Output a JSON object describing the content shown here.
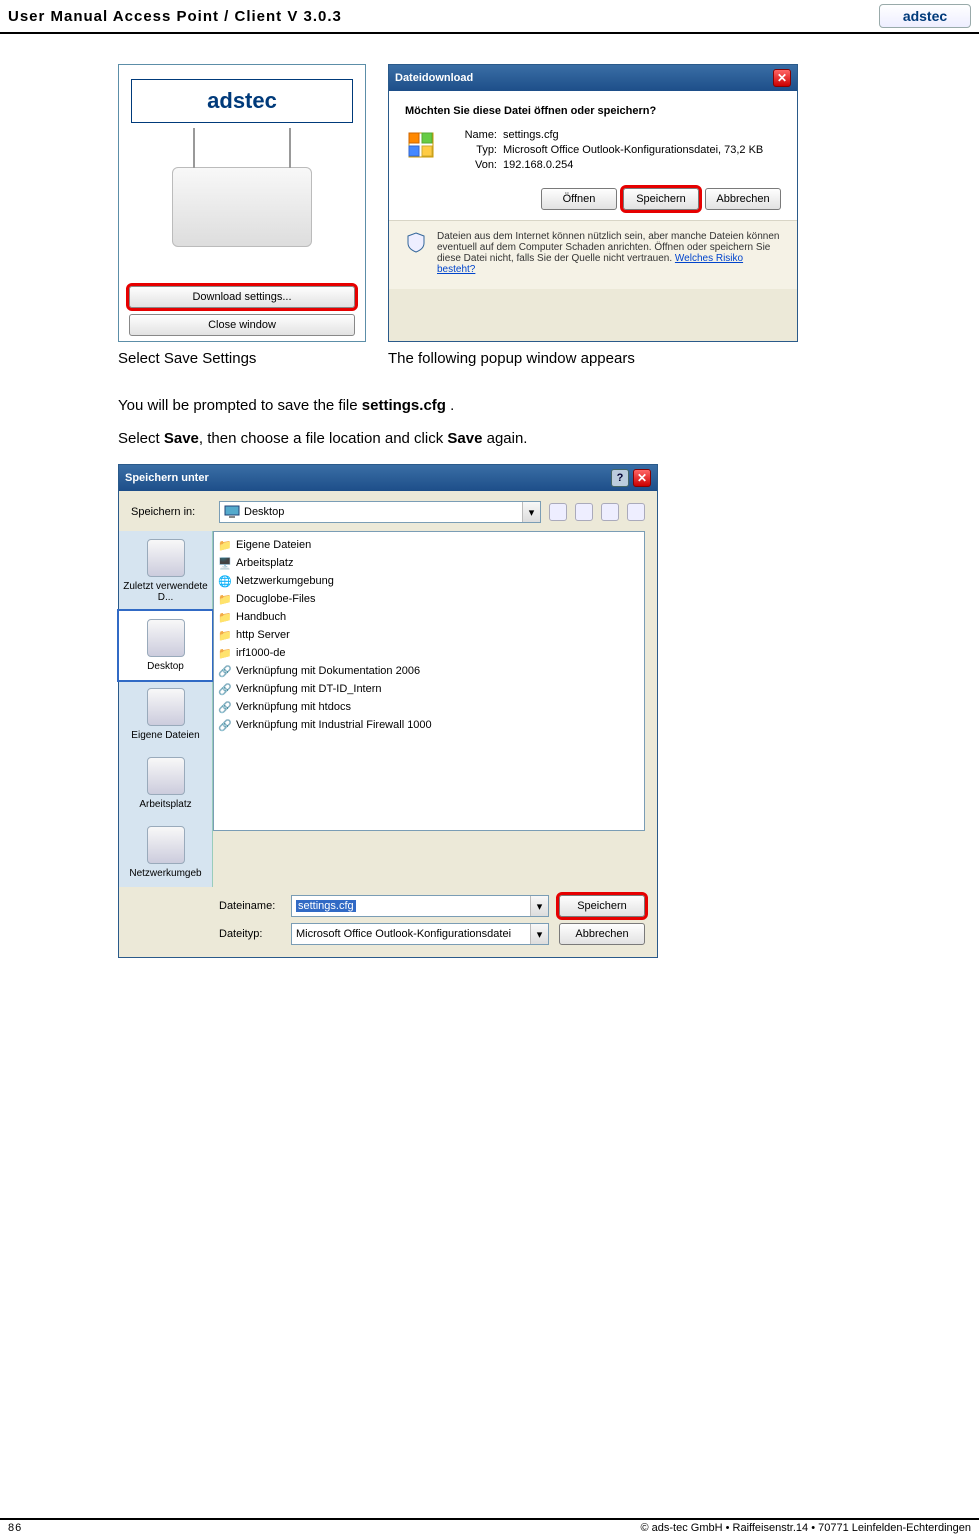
{
  "header": {
    "title": "User Manual Access Point / Client V 3.0.3",
    "logo": "adstec"
  },
  "app_window": {
    "logo": "adstec",
    "btn_download": "Download settings...",
    "btn_close": "Close window"
  },
  "download_dialog": {
    "title": "Dateidownload",
    "question": "Möchten Sie diese Datei öffnen oder speichern?",
    "labels": {
      "name": "Name:",
      "type": "Typ:",
      "from": "Von:"
    },
    "name": "settings.cfg",
    "type": "Microsoft Office Outlook-Konfigurationsdatei, 73,2 KB",
    "from": "192.168.0.254",
    "btn_open": "Öffnen",
    "btn_save": "Speichern",
    "btn_cancel": "Abbrechen",
    "warn_text": "Dateien aus dem Internet können nützlich sein, aber manche Dateien können eventuell auf dem Computer Schaden anrichten. Öffnen oder speichern Sie diese Datei nicht, falls Sie der Quelle nicht vertrauen.",
    "warn_link": "Welches Risiko besteht?"
  },
  "captions": {
    "c1": "Select Save Settings",
    "c2": "The following popup window appears"
  },
  "body": {
    "p1_a": "You will be prompted to save the file ",
    "p1_b": "settings.cfg",
    "p1_c": " .",
    "p2_a": "Select ",
    "p2_b": "Save",
    "p2_c": ", then choose a file location and click ",
    "p2_d": "Save",
    "p2_e": " again."
  },
  "save_dialog": {
    "title": "Speichern unter",
    "topbar": {
      "label": "Speichern in:",
      "value": "Desktop"
    },
    "places": [
      "Zuletzt verwendete D...",
      "Desktop",
      "Eigene Dateien",
      "Arbeitsplatz",
      "Netzwerkumgeb"
    ],
    "files": [
      "Eigene Dateien",
      "Arbeitsplatz",
      "Netzwerkumgebung",
      "Docuglobe-Files",
      "Handbuch",
      "http Server",
      "irf1000-de",
      "Verknüpfung mit Dokumentation 2006",
      "Verknüpfung mit DT-ID_Intern",
      "Verknüpfung mit htdocs",
      "Verknüpfung mit Industrial Firewall 1000"
    ],
    "filename_label": "Dateiname:",
    "filename": "settings.cfg",
    "filetype_label": "Dateityp:",
    "filetype": "Microsoft Office Outlook-Konfigurationsdatei",
    "btn_save": "Speichern",
    "btn_cancel": "Abbrechen"
  },
  "footer": {
    "page": "86",
    "copyright": "© ads-tec GmbH • Raiffeisenstr.14 • 70771 Leinfelden-Echterdingen"
  }
}
